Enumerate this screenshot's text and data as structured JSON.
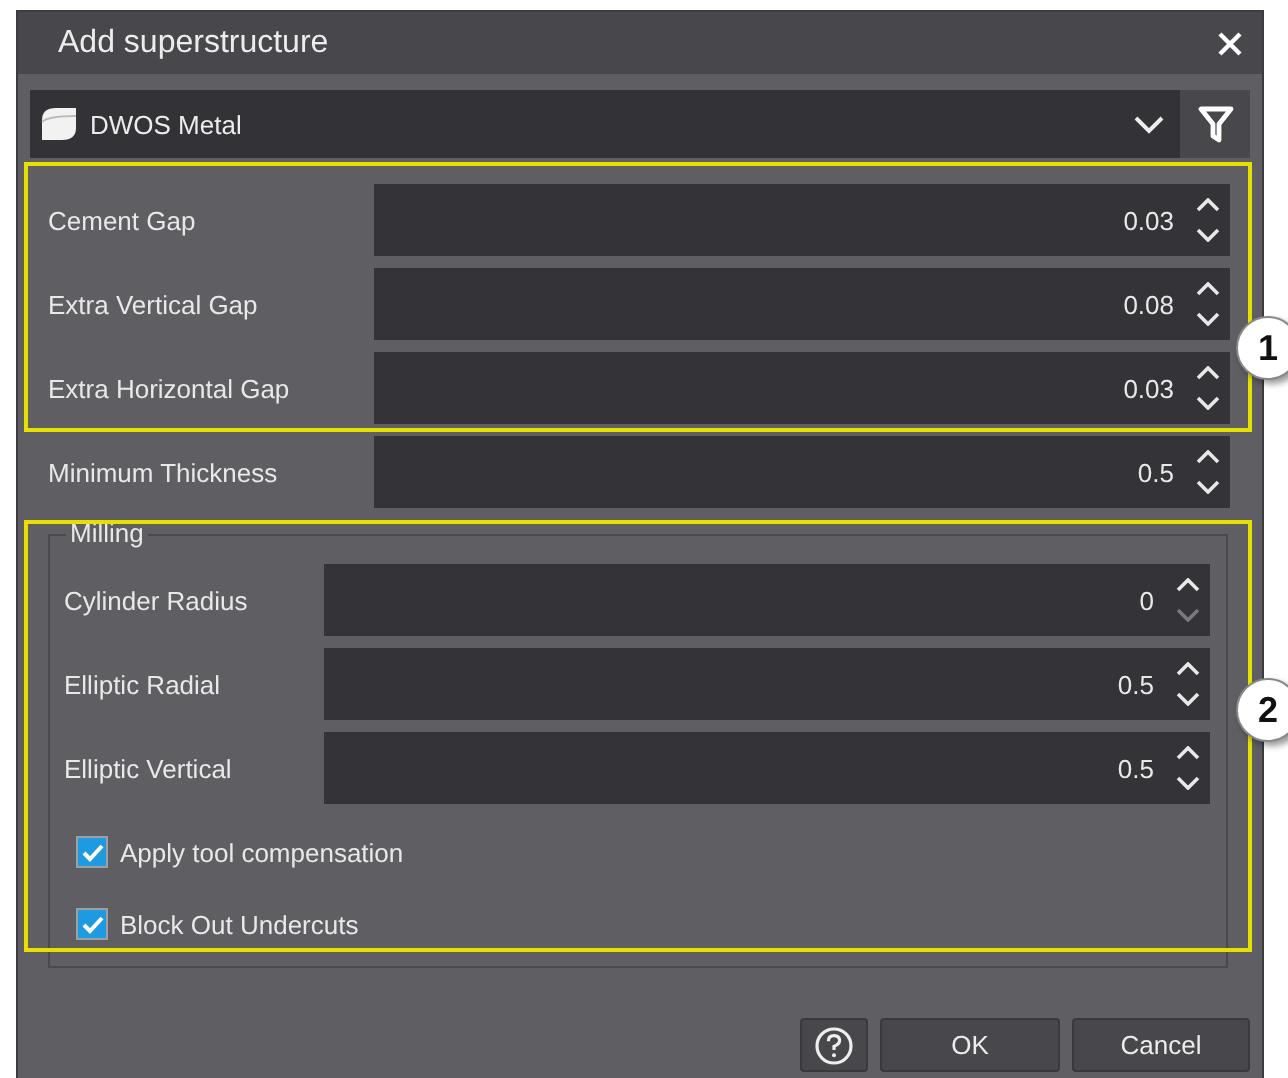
{
  "window": {
    "title": "Add superstructure"
  },
  "material": {
    "value": "DWOS Metal"
  },
  "fields": [
    {
      "label": "Cement Gap",
      "value": "0.03",
      "down_enabled": true
    },
    {
      "label": "Extra Vertical Gap",
      "value": "0.08",
      "down_enabled": true
    },
    {
      "label": "Extra Horizontal Gap",
      "value": "0.03",
      "down_enabled": true
    },
    {
      "label": "Minimum Thickness",
      "value": "0.5",
      "down_enabled": true
    }
  ],
  "milling": {
    "title": "Milling",
    "fields": [
      {
        "label": "Cylinder Radius",
        "value": "0",
        "down_enabled": false
      },
      {
        "label": "Elliptic Radial",
        "value": "0.5",
        "down_enabled": true
      },
      {
        "label": "Elliptic Vertical",
        "value": "0.5",
        "down_enabled": true
      }
    ],
    "options": [
      {
        "label": "Apply tool compensation",
        "checked": true
      },
      {
        "label": "Block Out Undercuts",
        "checked": true
      }
    ]
  },
  "highlights": [
    {
      "number": "1"
    },
    {
      "number": "2"
    }
  ],
  "buttons": [
    {
      "kind": "help"
    },
    {
      "kind": "text",
      "label": "OK"
    },
    {
      "kind": "text",
      "label": "Cancel"
    }
  ]
}
